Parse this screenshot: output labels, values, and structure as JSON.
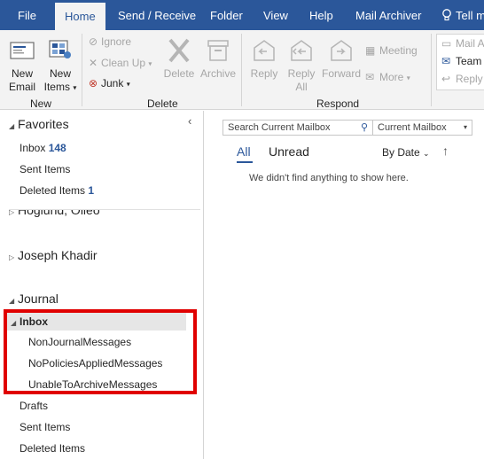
{
  "tabs": [
    {
      "label": "File"
    },
    {
      "label": "Home"
    },
    {
      "label": "Send / Receive"
    },
    {
      "label": "Folder"
    },
    {
      "label": "View"
    },
    {
      "label": "Help"
    },
    {
      "label": "Mail Archiver"
    },
    {
      "label": "Tell m"
    }
  ],
  "ribbon": {
    "new_group": {
      "label": "New",
      "new_email": "New Email",
      "new_email_l1": "New",
      "new_email_l2": "Email",
      "new_items_l1": "New",
      "new_items_l2": "Items"
    },
    "delete_group": {
      "label": "Delete",
      "ignore": "Ignore",
      "clean_up": "Clean Up",
      "junk": "Junk",
      "delete": "Delete",
      "archive": "Archive"
    },
    "respond_group": {
      "label": "Respond",
      "reply": "Reply",
      "reply_all_l1": "Reply",
      "reply_all_l2": "All",
      "forward": "Forward",
      "meeting": "Meeting",
      "more": "More"
    },
    "quick_steps": {
      "mail_a": "Mail A",
      "team": "Team",
      "reply": "Reply"
    }
  },
  "folder_pane": {
    "favorites_header": "Favorites",
    "favorites": [
      {
        "name": "Inbox",
        "count": "148"
      },
      {
        "name": "Sent Items",
        "count": ""
      },
      {
        "name": "Deleted Items",
        "count": "1"
      }
    ],
    "account_partial": "Hoglund, Olleo",
    "account_joseph": "Joseph Khadir",
    "account_journal": "Journal",
    "inbox_label": "Inbox",
    "inbox_subfolders": [
      "NonJournalMessages",
      "NoPoliciesAppliedMessages",
      "UnableToArchiveMessages"
    ],
    "other_folders": [
      "Drafts",
      "Sent Items",
      "Deleted Items"
    ]
  },
  "message_list": {
    "search_placeholder": "Search Current Mailbox",
    "scope": "Current Mailbox",
    "filter_all": "All",
    "filter_unread": "Unread",
    "sort": "By Date",
    "empty_text": "We didn't find anything to show here."
  },
  "colors": {
    "accent": "#2b579a",
    "highlight": "#e00000"
  }
}
